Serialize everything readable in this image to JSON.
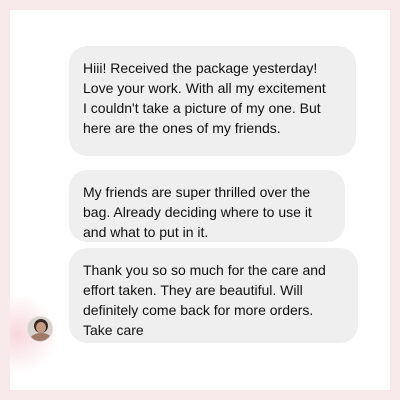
{
  "messages": [
    {
      "text": "Hiii! Received the package yesterday!\nLove your work. With all my excitement\nI couldn't take a picture of my one. But\nhere are the ones of my friends."
    },
    {
      "text": "My friends are super thrilled over the\nbag. Already deciding where to use it\nand what to put in it."
    },
    {
      "text": "Thank you so so much for the care and\neffort taken. They are beautiful. Will\ndefinitely come back for more orders.\nTake care"
    }
  ],
  "colors": {
    "background": "#f8e9ea",
    "bubble": "#efefef",
    "text": "#111111"
  },
  "icons": {
    "avatar": "sender-avatar"
  }
}
